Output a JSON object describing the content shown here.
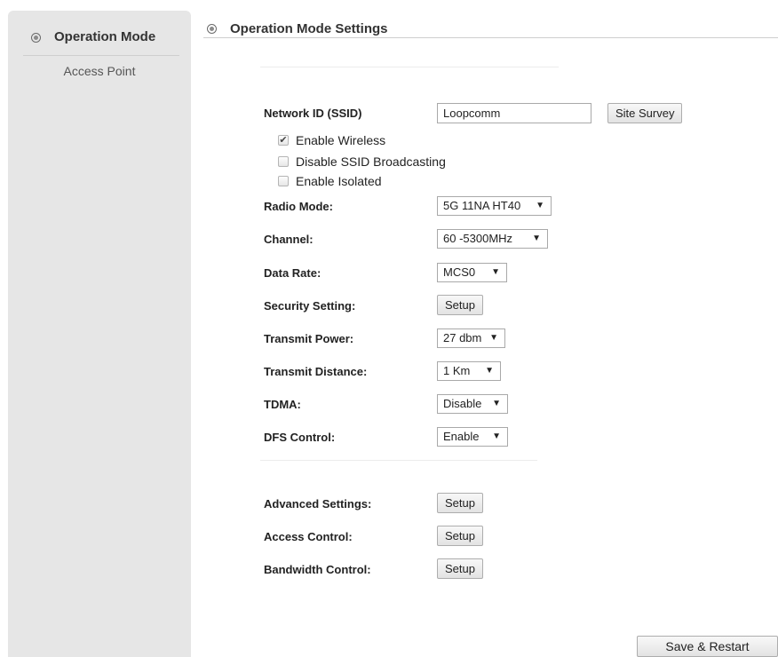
{
  "sidebar": {
    "title": "Operation Mode",
    "title_icon": "ring-icon",
    "items": [
      {
        "label": "Access Point"
      }
    ]
  },
  "main": {
    "title": "Operation Mode Settings",
    "title_icon": "ring-icon"
  },
  "form": {
    "ssid": {
      "label": "Network ID (SSID)",
      "value": "Loopcomm",
      "button": "Site Survey"
    },
    "checkboxes": [
      {
        "label": "Enable Wireless",
        "checked": true
      },
      {
        "label": "Disable SSID Broadcasting",
        "checked": false
      },
      {
        "label": "Enable Isolated",
        "checked": false
      }
    ],
    "radio_mode": {
      "label": "Radio Mode:",
      "value": "5G 11NA HT40"
    },
    "channel": {
      "label": "Channel:",
      "value": "60 -5300MHz"
    },
    "data_rate": {
      "label": "Data Rate:",
      "value": "MCS0"
    },
    "security": {
      "label": "Security Setting:",
      "button": "Setup"
    },
    "transmit_power": {
      "label": "Transmit Power:",
      "value": "27 dbm"
    },
    "transmit_distance": {
      "label": "Transmit Distance:",
      "value": "1 Km"
    },
    "tdma": {
      "label": "TDMA:",
      "value": "Disable"
    },
    "dfs": {
      "label": "DFS Control:",
      "value": "Enable"
    },
    "advanced": {
      "label": "Advanced Settings:",
      "button": "Setup"
    },
    "access_control": {
      "label": "Access Control:",
      "button": "Setup"
    },
    "bandwidth": {
      "label": "Bandwidth Control:",
      "button": "Setup"
    }
  },
  "save_button": "Save & Restart",
  "colors": {
    "sidebar_bg": "#e6e6e6",
    "page_bg": "#ffffff"
  }
}
